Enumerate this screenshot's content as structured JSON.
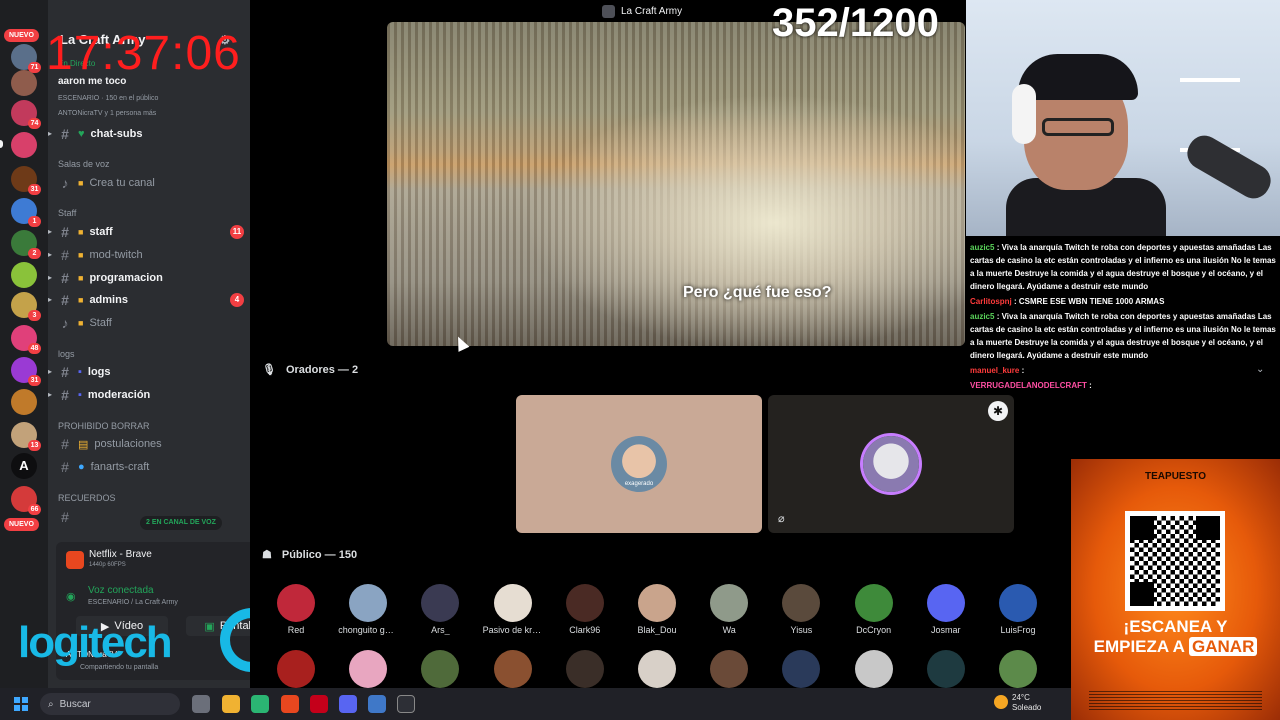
{
  "overlay": {
    "clock": "17:37:06",
    "counter": "352/1200",
    "subtitle": "Pero ¿qué fue eso?",
    "logitech": "logitech"
  },
  "window": {
    "title": "La Craft Army"
  },
  "rail": {
    "nuevo_top": "NUEVO",
    "nuevo_bottom": "NUEVO",
    "badges": [
      "71",
      "74",
      "31",
      "1",
      "2",
      "3",
      "48",
      "31",
      "13",
      "66"
    ]
  },
  "server": {
    "name": "La Craft Army",
    "live_label": "En Directo",
    "stage_title": "aaron me toco",
    "stage_sub": "ESCENARIO · 150 en el público",
    "stage_sub2": "ANTONicraTV y 1 persona más"
  },
  "channels": {
    "chat_subs": "chat-subs",
    "voice_category": "Salas de voz",
    "create_channel": "Crea tu canal",
    "staff_category": "Staff",
    "staff": "staff",
    "staff_badge": "11",
    "mod_twitch": "mod-twitch",
    "programacion": "programacion",
    "admins": "admins",
    "admins_badge": "4",
    "staff_voice": "Staff",
    "logs_category": "logs",
    "logs": "logs",
    "moderacion": "moderación",
    "prohibido_category": "PROHIBIDO BORRAR",
    "postulaciones": "postulaciones",
    "fanarts": "fanarts-craft",
    "recuerdos_category": "RECUERDOS",
    "voice_pill": "2 EN CANAL DE VOZ"
  },
  "panel": {
    "now_playing": "Netflix - Brave",
    "quality": "1440p 60FPS",
    "voice_connected": "Voz conectada",
    "voice_location": "ESCENARIO / La Craft Army",
    "video_label": "Vídeo",
    "screen_label": "Pantalla",
    "user": "ANTONicraTV",
    "user_status": "Compartiendo tu pantalla"
  },
  "stage": {
    "speakers_header": "Oradores — 2",
    "audience_header": "Público — 150",
    "speaker_label": "exagerado"
  },
  "audience": [
    {
      "name": "Red",
      "color": "#c0283a"
    },
    {
      "name": "chonguito gue...",
      "color": "#8aa4c2"
    },
    {
      "name": "Ars_",
      "color": "#3a3a52"
    },
    {
      "name": "Pasivo de kro...",
      "color": "#e6ddd2"
    },
    {
      "name": "Clark96",
      "color": "#4a2a24"
    },
    {
      "name": "Blak_Dou",
      "color": "#c9a48c"
    },
    {
      "name": "Wa",
      "color": "#8f9a8a"
    },
    {
      "name": "Yisus",
      "color": "#5a4a3c"
    },
    {
      "name": "DcCryon",
      "color": "#3e8a3a"
    },
    {
      "name": "Josmar",
      "color": "#5865f2"
    },
    {
      "name": "LuisFrog",
      "color": "#2a5ab0"
    }
  ],
  "audience_row2": [
    "#a8201e",
    "#e8a6c0",
    "#4f6a3a",
    "#8a5030",
    "#3a2e28",
    "#d8d0c8",
    "#6a4a38",
    "#2a3a5a",
    "#c8c8c8",
    "#1e3a40",
    "#5c8a4a"
  ],
  "chat": [
    {
      "user": "auzic5",
      "text": "Viva la anarquía Twitch te roba con deportes y apuestas amañadas Las cartas de casino la etc están controladas y el infierno es una ilusión No le temas a la muerte Destruye la comida y el agua destruye el bosque y el océano, y el dinero llegará. Ayúdame a destruir este mundo",
      "cls": "u-green"
    },
    {
      "user": "Carlitospnj",
      "text": "CSMRE ESE WBN TIENE 1000 ARMAS",
      "cls": "u-red"
    },
    {
      "user": "auzic5",
      "text": "Viva la anarquía Twitch te roba con deportes y apuestas amañadas Las cartas de casino la etc están controladas y el infierno es una ilusión No le temas a la muerte Destruye la comida y el agua destruye el bosque y el océano, y el dinero llegará. Ayúdame a destruir este mundo",
      "cls": "u-green"
    },
    {
      "user": "manuel_kure",
      "text": "",
      "cls": "u-red"
    },
    {
      "user": "VERRUGADELANODELCRAFT",
      "text": "",
      "cls": "u-pink"
    }
  ],
  "ad": {
    "brand": "TEAPUESTO",
    "line1": "¡ESCANEA Y",
    "line2_pre": "EMPIEZA A",
    "line2_hl": "GANAR"
  },
  "taskbar": {
    "search_placeholder": "Buscar",
    "temp": "24°C",
    "weather": "Soleado"
  },
  "colors": {
    "discord_bg": "#2b2d31",
    "rail_bg": "#1e1f22",
    "mention_red": "#f23f43",
    "online_green": "#23a55a",
    "clock_red": "#ff1e1e",
    "logitech_blue": "#18b9e6",
    "ad_orange": "#e65a0a"
  }
}
